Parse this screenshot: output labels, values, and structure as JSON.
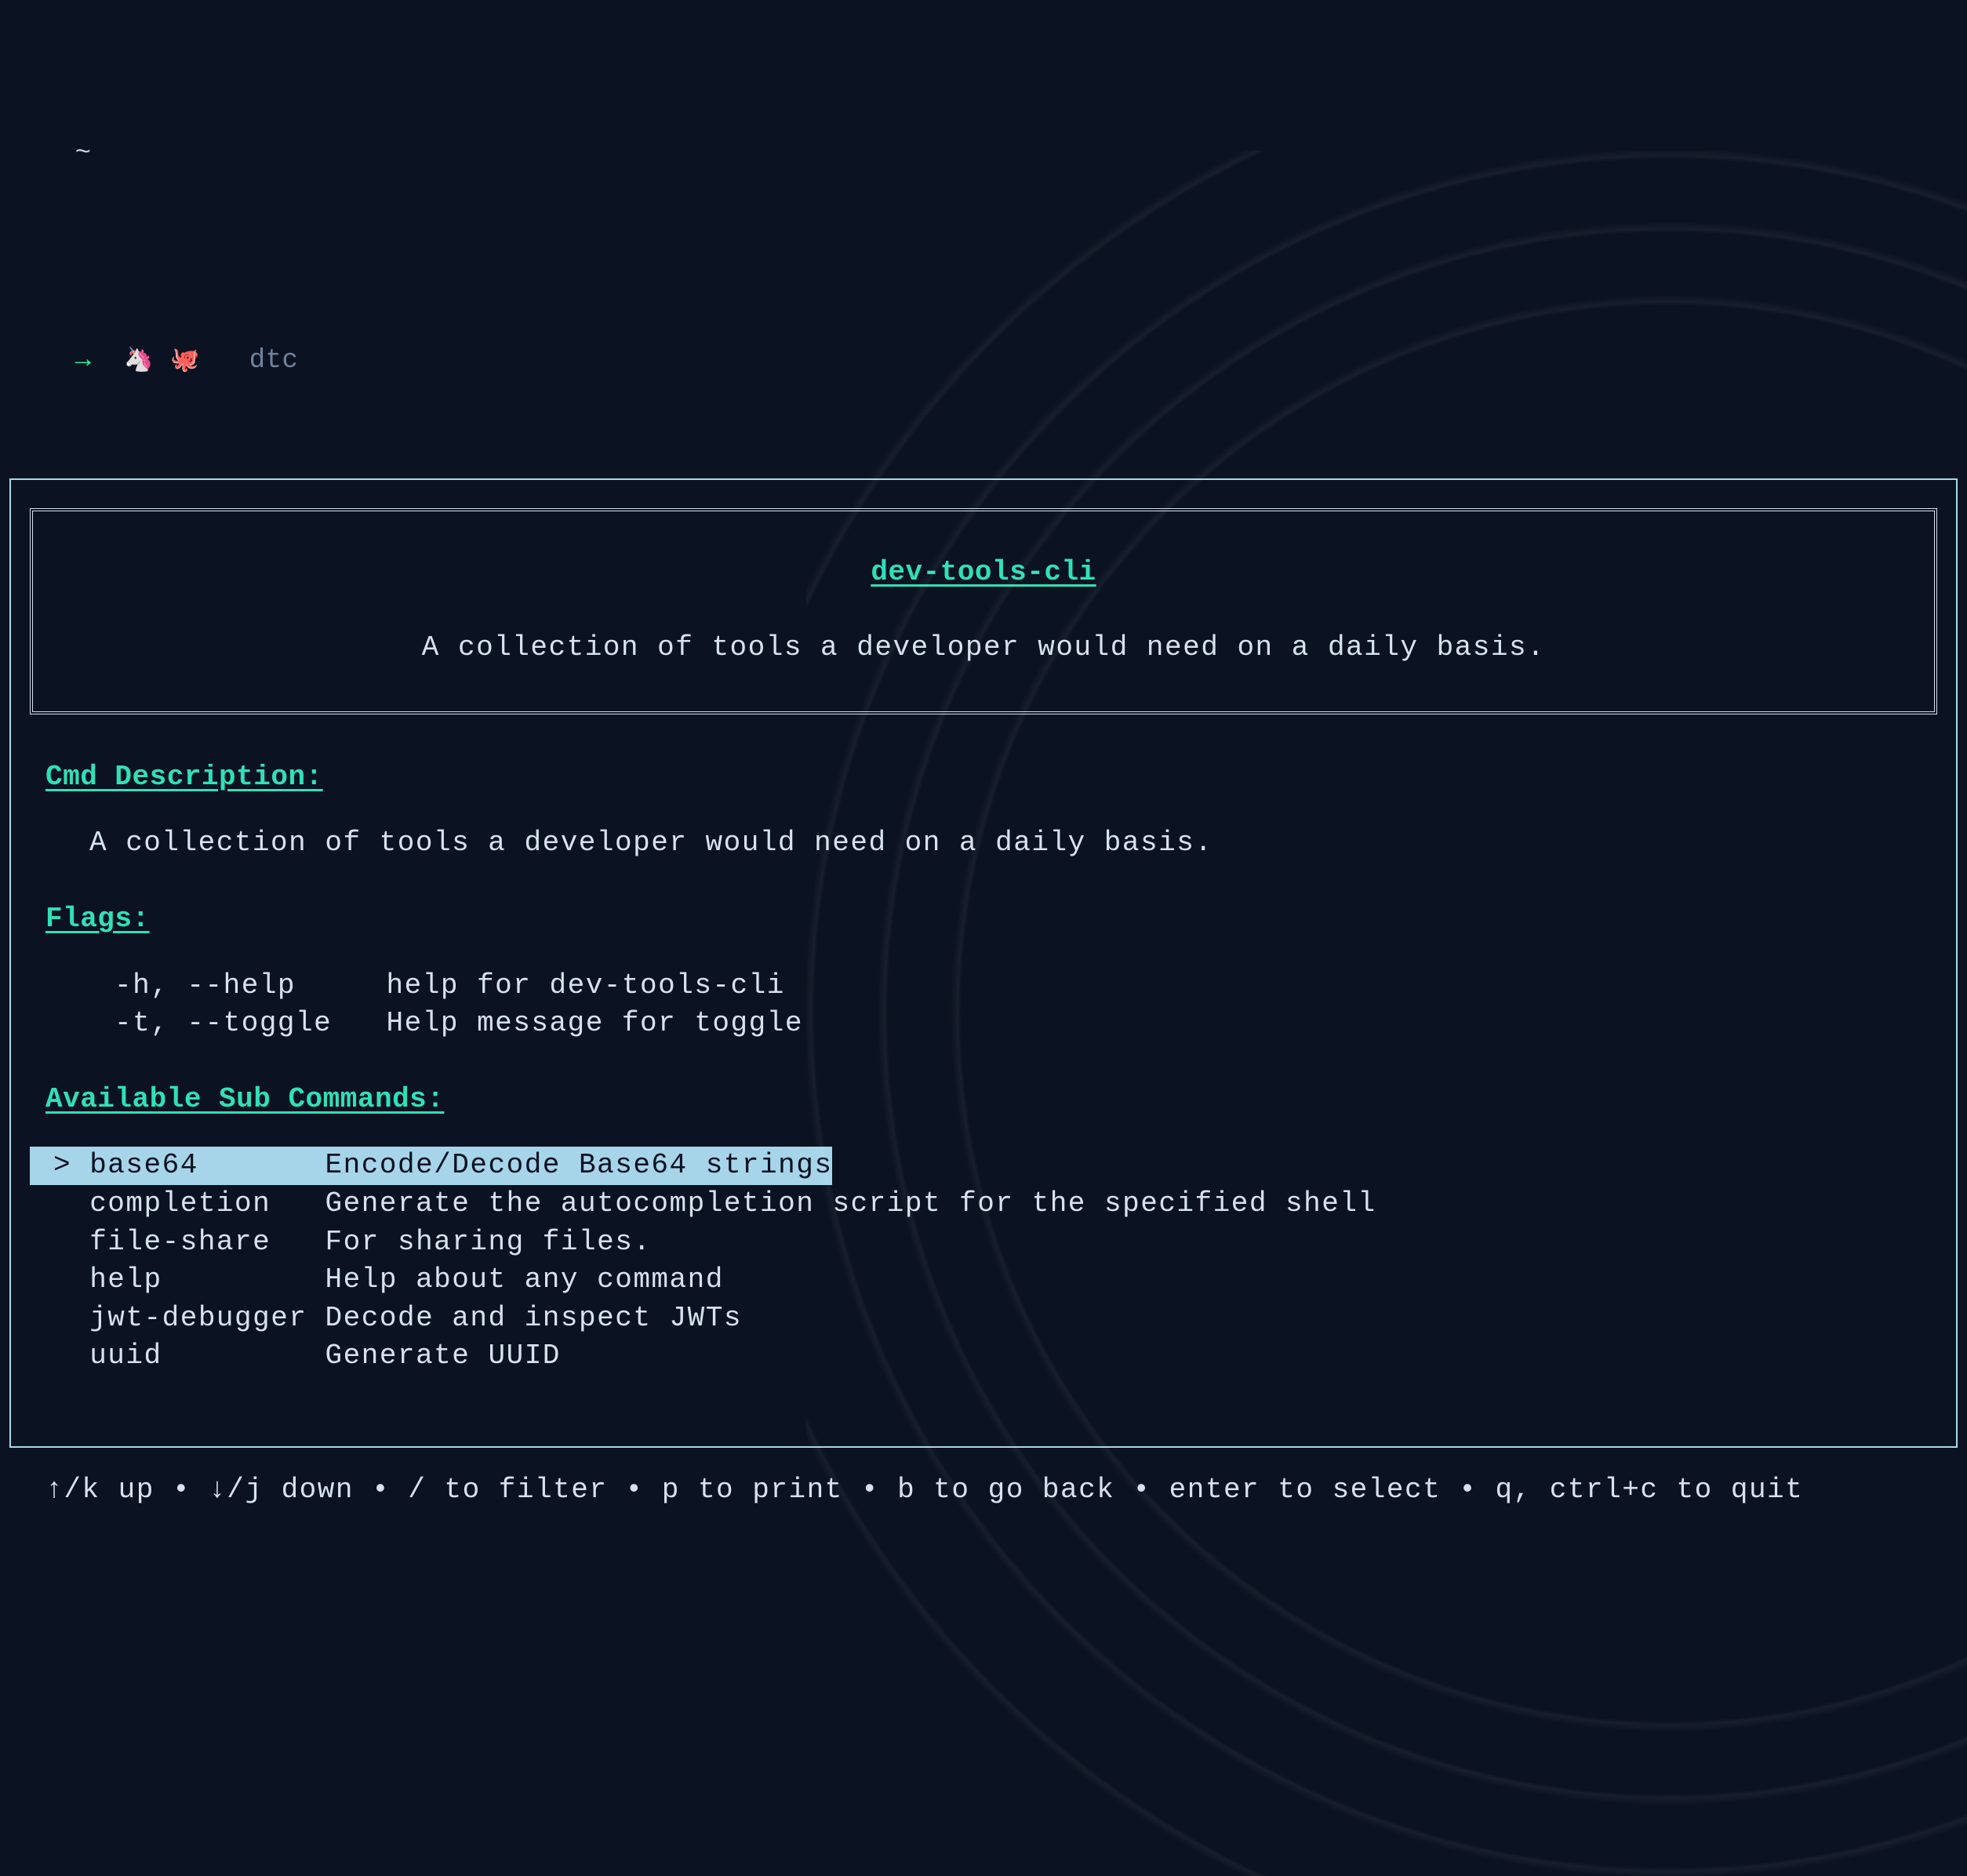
{
  "prompt": {
    "line1_tilde": "~",
    "arrow": "→",
    "emoji1": "🦄",
    "emoji2": "🐙",
    "command": "dtc"
  },
  "banner": {
    "title": "dev-tools-cli",
    "subtitle": "A collection of tools a developer would need on a daily basis."
  },
  "headings": {
    "cmd_desc": "Cmd Description:",
    "flags": "Flags:",
    "subcmds": "Available Sub Commands:"
  },
  "cmd_description": "A collection of tools a developer would need on a daily basis.",
  "flags": [
    {
      "flag": "-h, --help",
      "pad": "     ",
      "desc": "help for dev-tools-cli"
    },
    {
      "flag": "-t, --toggle",
      "pad": "   ",
      "desc": "Help message for toggle"
    }
  ],
  "selection_marker": "> ",
  "subcommands": [
    {
      "name": "base64",
      "pad": "       ",
      "desc": "Encode/Decode Base64 strings",
      "selected": true
    },
    {
      "name": "completion",
      "pad": "   ",
      "desc": "Generate the autocompletion script for the specified shell",
      "selected": false
    },
    {
      "name": "file-share",
      "pad": "   ",
      "desc": "For sharing files.",
      "selected": false
    },
    {
      "name": "help",
      "pad": "         ",
      "desc": "Help about any command",
      "selected": false
    },
    {
      "name": "jwt-debugger",
      "pad": " ",
      "desc": "Decode and inspect JWTs",
      "selected": false
    },
    {
      "name": "uuid",
      "pad": "         ",
      "desc": "Generate UUID",
      "selected": false
    }
  ],
  "footer_keys": "↑/k up • ↓/j down • / to filter • p to print • b to go back • enter to select • q, ctrl+c to quit"
}
